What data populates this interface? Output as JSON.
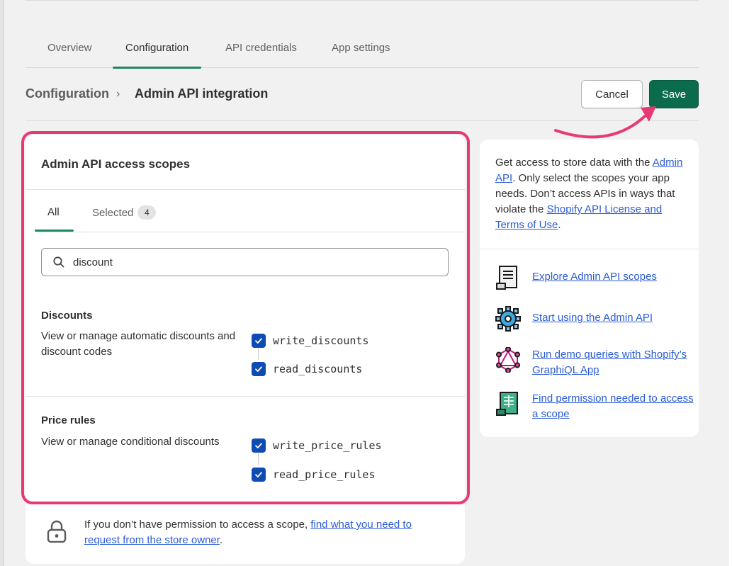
{
  "tabs": [
    {
      "label": "Overview",
      "active": false
    },
    {
      "label": "Configuration",
      "active": true
    },
    {
      "label": "API credentials",
      "active": false
    },
    {
      "label": "App settings",
      "active": false
    }
  ],
  "header": {
    "breadcrumb_root": "Configuration",
    "breadcrumb_separator": "›",
    "title": "Admin API integration",
    "cancel_label": "Cancel",
    "save_label": "Save"
  },
  "scopes_card": {
    "title": "Admin API access scopes",
    "tabs": {
      "all_label": "All",
      "selected_label": "Selected",
      "selected_count": "4"
    },
    "search": {
      "value": "discount",
      "placeholder": ""
    },
    "groups": [
      {
        "title": "Discounts",
        "description": "View or manage automatic discounts and discount codes",
        "scopes": [
          {
            "label": "write_discounts",
            "checked": true
          },
          {
            "label": "read_discounts",
            "checked": true
          }
        ]
      },
      {
        "title": "Price rules",
        "description": "View or manage conditional discounts",
        "scopes": [
          {
            "label": "write_price_rules",
            "checked": true
          },
          {
            "label": "read_price_rules",
            "checked": true
          }
        ]
      }
    ]
  },
  "footer": {
    "text": "If you don’t have permission to access a scope,",
    "link": "find what you need to request from the store owner",
    "end": "."
  },
  "side": {
    "intro_1": "Get access to store data with the",
    "intro_link_1": "Admin API",
    "intro_2": ". Only select the scopes your app needs. Don’t access APIs in ways that violate the",
    "intro_link_2": "Shopify API License and Terms of Use",
    "intro_3": ".",
    "resources": [
      {
        "label": "Explore Admin API scopes",
        "icon": "scroll-icon"
      },
      {
        "label": "Start using the Admin API",
        "icon": "gear-icon"
      },
      {
        "label": "Run demo queries with Shopify’s GraphiQL App",
        "icon": "graphql-icon"
      },
      {
        "label": "Find permission needed to access a scope",
        "icon": "document-scroll-icon"
      }
    ]
  },
  "colors": {
    "accent": "#1f8763",
    "save_button": "#0b6b4d",
    "checkbox": "#0e4bb3",
    "highlight": "#e83a72",
    "link": "#2b5cd6"
  }
}
